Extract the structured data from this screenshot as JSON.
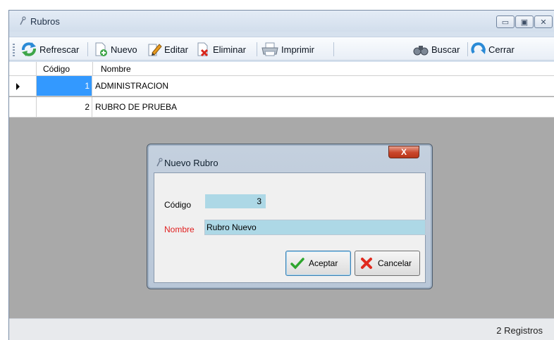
{
  "window": {
    "title": "Rubros",
    "controls": [
      "minimize",
      "maximize",
      "close"
    ]
  },
  "toolbar": {
    "refresh_label": "Refrescar",
    "new_label": "Nuevo",
    "edit_label": "Editar",
    "delete_label": "Eliminar",
    "print_label": "Imprimir",
    "search_label": "Buscar",
    "close_label": "Cerrar"
  },
  "grid": {
    "columns": [
      "Código",
      "Nombre"
    ],
    "rows": [
      {
        "codigo": "1",
        "nombre": "ADMINISTRACION",
        "selected": true
      },
      {
        "codigo": "2",
        "nombre": "RUBRO DE PRUEBA",
        "selected": false
      }
    ]
  },
  "status": {
    "records": "2 Registros"
  },
  "dialog": {
    "title": "Nuevo Rubro",
    "close_label": "X",
    "codigo_label": "Código",
    "codigo_value": "3",
    "nombre_label": "Nombre",
    "nombre_value": "Rubro Nuevo",
    "accept_label": "Aceptar",
    "cancel_label": "Cancelar"
  },
  "colors": {
    "selection": "#3399ff",
    "input_bg": "#add8e6",
    "required_label": "#e02020"
  }
}
